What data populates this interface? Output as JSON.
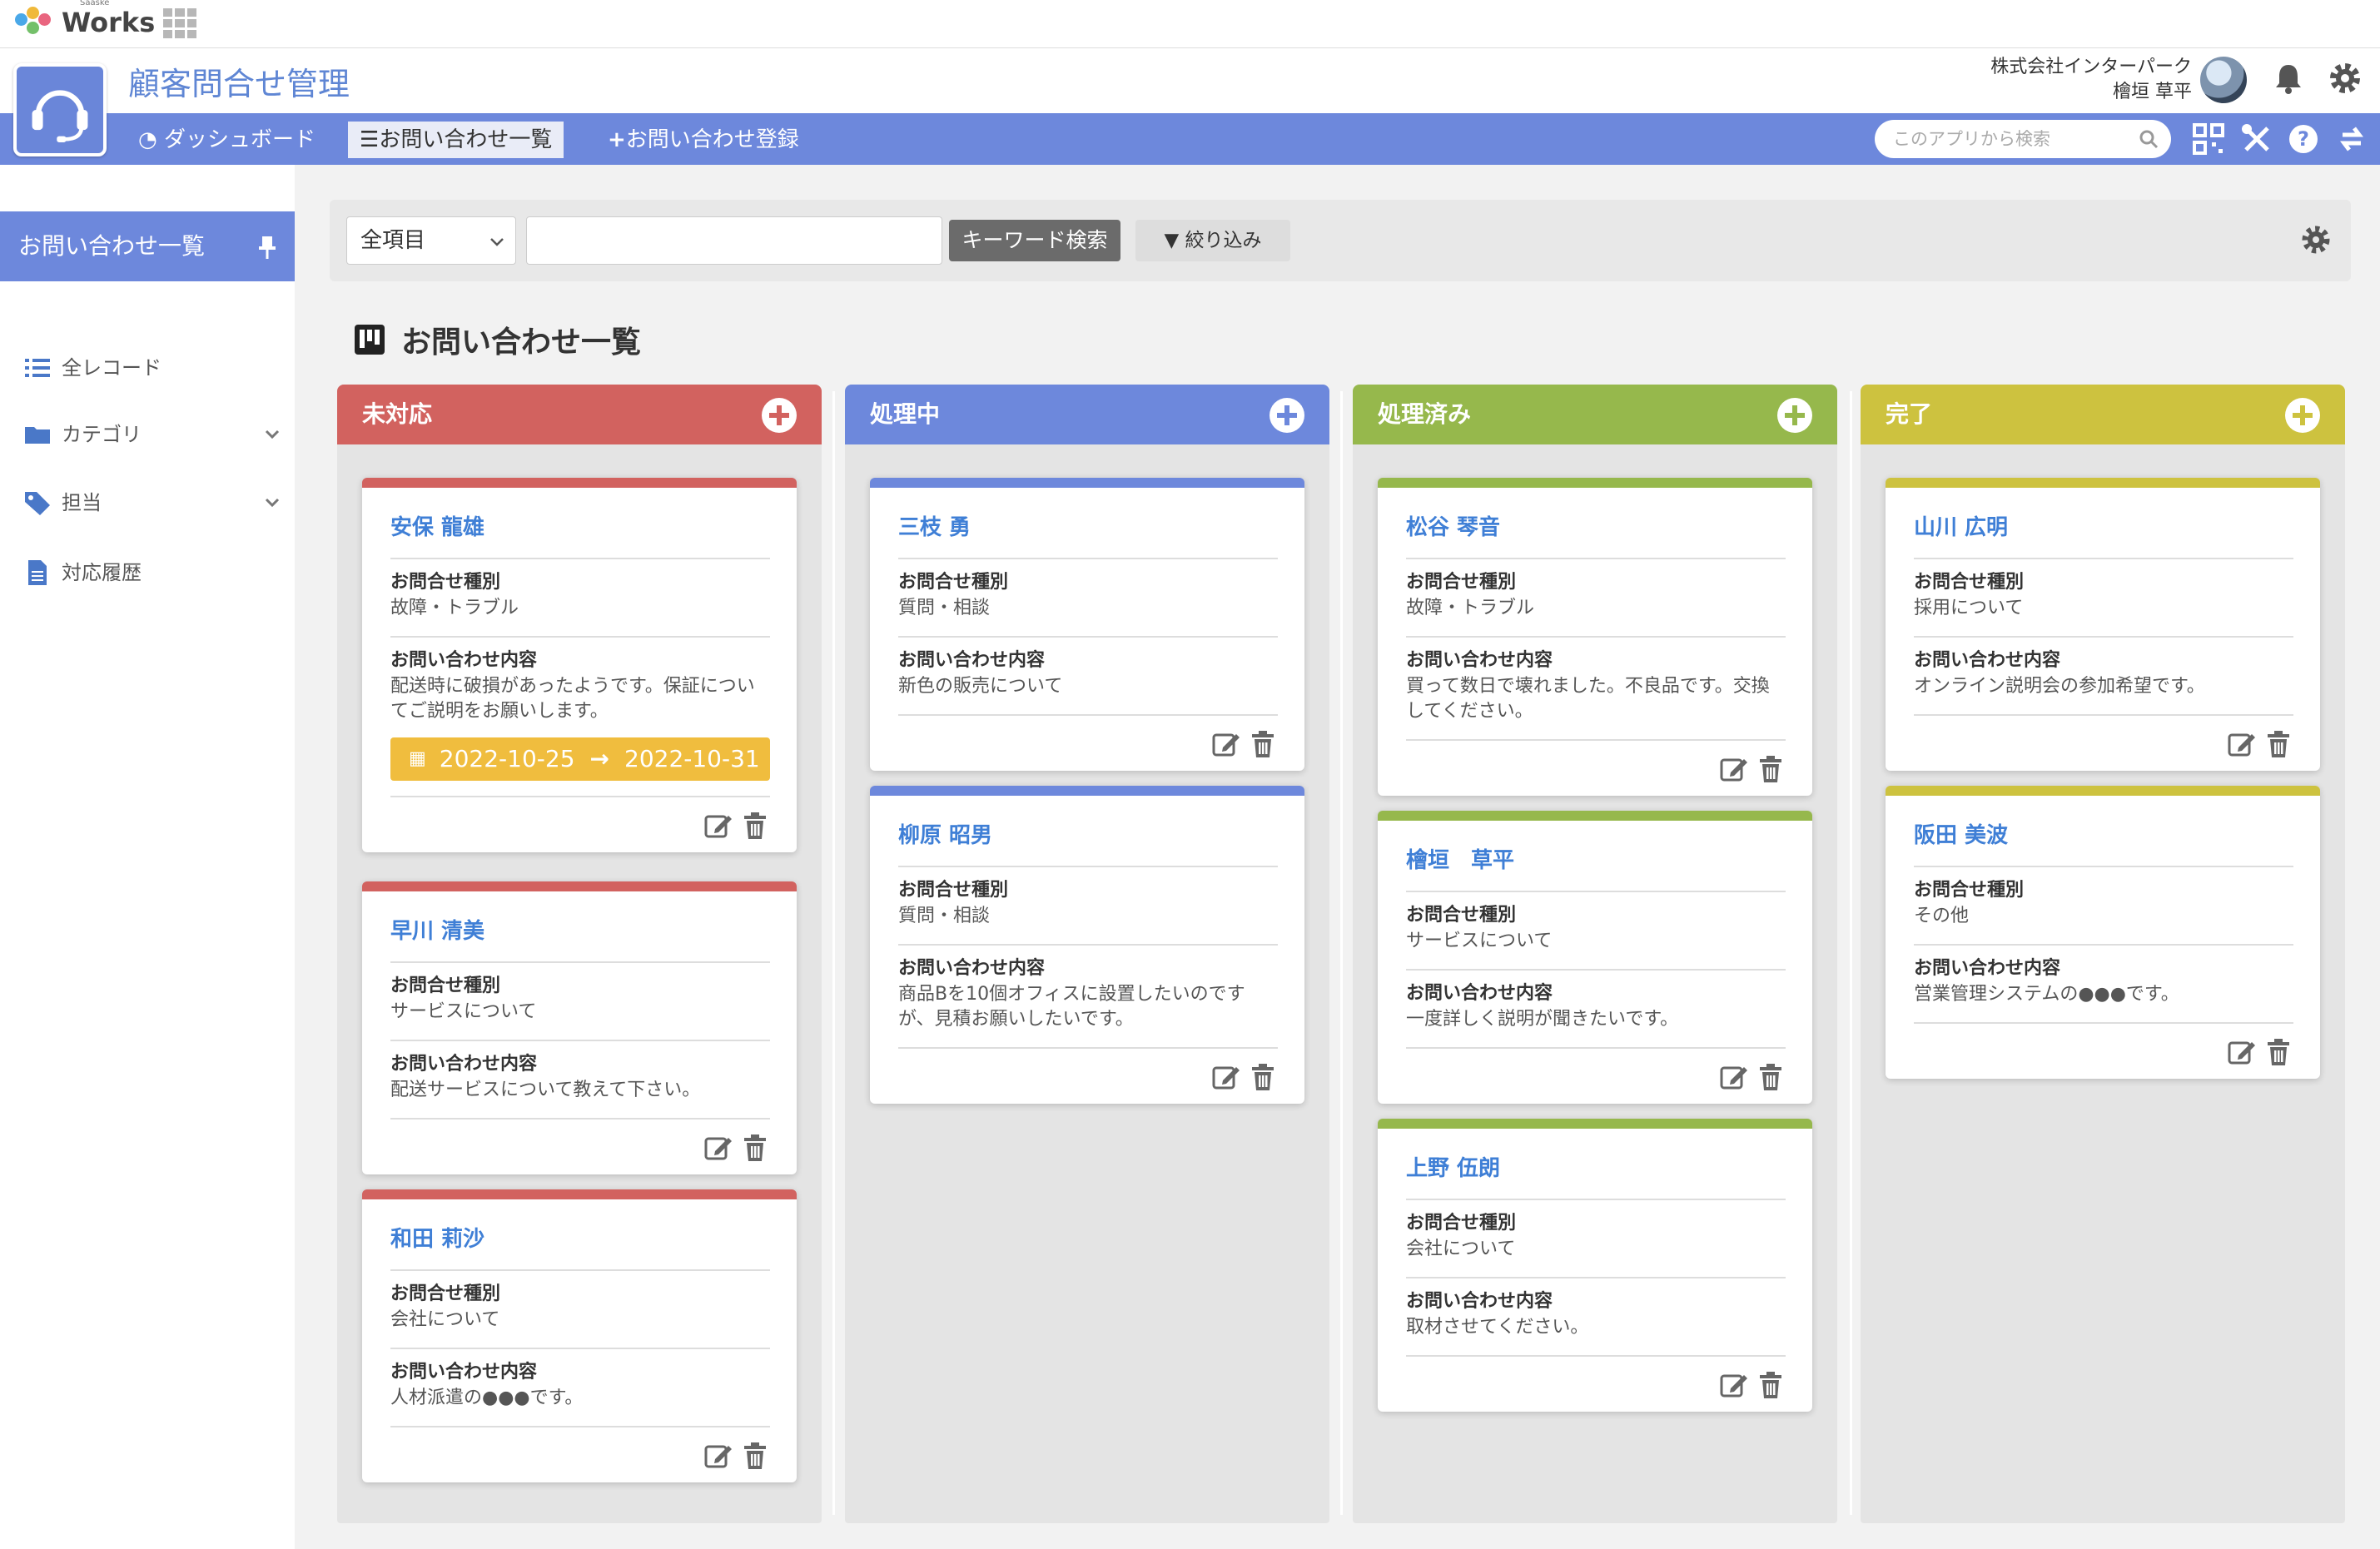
{
  "brand": {
    "name": "Works",
    "sub": "Saaske"
  },
  "app": {
    "title": "顧客問合せ管理",
    "company": "株式会社インターパーク",
    "user": "檜垣 草平"
  },
  "nav": {
    "dashboard": "ダッシュボード",
    "list": "お問い合わせ一覧",
    "register": "お問い合わせ登録",
    "search_placeholder": "このアプリから検索"
  },
  "sidebar": {
    "header": "お問い合わせ一覧",
    "items": [
      {
        "label": "全レコード"
      },
      {
        "label": "カテゴリ"
      },
      {
        "label": "担当"
      },
      {
        "label": "対応履歴"
      }
    ]
  },
  "filter": {
    "select_value": "全項目",
    "keyword_button": "キーワード検索",
    "narrow_button": "絞り込み"
  },
  "page_title": "お問い合わせ一覧",
  "colors": {
    "primary": "#6d88dc",
    "todo": "#d2625f",
    "doing": "#6d88dc",
    "done": "#96b84c",
    "complete": "#cdc23f",
    "date_badge": "#f0bd3e",
    "link": "#3f7fd6"
  },
  "card_labels": {
    "type": "お問合せ種別",
    "content": "お問い合わせ内容"
  },
  "columns": [
    {
      "title": "未対応",
      "cards": [
        {
          "name": "安保 龍雄",
          "type": "故障・トラブル",
          "content": "配送時に破損があったようです。保証についてご説明をお願いします。",
          "date_from": "2022-10-25",
          "date_to": "2022-10-31"
        },
        {
          "name": "早川 清美",
          "type": "サービスについて",
          "content": "配送サービスについて教えて下さい。"
        },
        {
          "name": "和田 莉沙",
          "type": "会社について",
          "content": "人材派遣の●●●です。"
        }
      ]
    },
    {
      "title": "処理中",
      "cards": [
        {
          "name": "三枝 勇",
          "type": "質問・相談",
          "content": "新色の販売について"
        },
        {
          "name": "柳原 昭男",
          "type": "質問・相談",
          "content": "商品Bを10個オフィスに設置したいのですが、見積お願いしたいです。"
        }
      ]
    },
    {
      "title": "処理済み",
      "cards": [
        {
          "name": "松谷 琴音",
          "type": "故障・トラブル",
          "content": "買って数日で壊れました。不良品です。交換してください。"
        },
        {
          "name": "檜垣　草平",
          "type": "サービスについて",
          "content": "一度詳しく説明が聞きたいです。"
        },
        {
          "name": "上野 伍朗",
          "type": "会社について",
          "content": "取材させてください。"
        }
      ]
    },
    {
      "title": "完了",
      "cards": [
        {
          "name": "山川 広明",
          "type": "採用について",
          "content": "オンライン説明会の参加希望です。"
        },
        {
          "name": "阪田 美波",
          "type": "その他",
          "content": "営業管理システムの●●●です。"
        }
      ]
    }
  ]
}
